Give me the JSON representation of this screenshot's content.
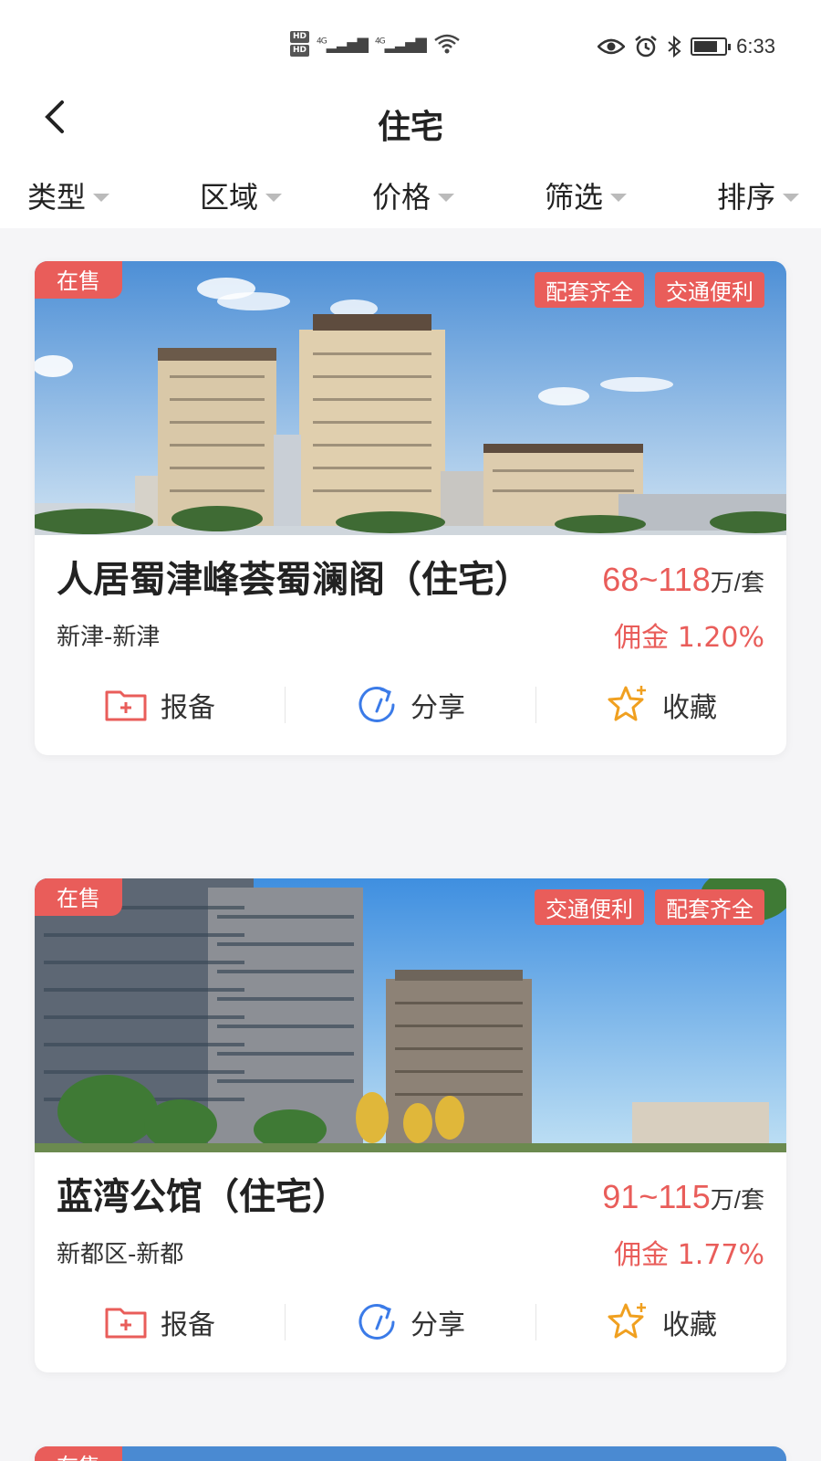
{
  "status": {
    "time": "6:33",
    "hd1": "HD",
    "hd2": "HD",
    "net1": "4G",
    "net2": "4G"
  },
  "header": {
    "title": "住宅"
  },
  "filters": [
    {
      "label": "类型"
    },
    {
      "label": "区域"
    },
    {
      "label": "价格"
    },
    {
      "label": "筛选"
    },
    {
      "label": "排序"
    }
  ],
  "colors": {
    "accent": "#e95d5a",
    "share_blue": "#3b7be8",
    "star_orange": "#f0a020"
  },
  "listings": [
    {
      "status": "在售",
      "tags": [
        "配套齐全",
        "交通便利"
      ],
      "name": "人居蜀津峰荟蜀澜阁（住宅）",
      "price": "68~118",
      "unit": "万/套",
      "area": "新津-新津",
      "commission": "佣金 1.20%",
      "actions": {
        "report": "报备",
        "share": "分享",
        "favorite": "收藏"
      }
    },
    {
      "status": "在售",
      "tags": [
        "交通便利",
        "配套齐全"
      ],
      "name": "蓝湾公馆（住宅）",
      "price": "91~115",
      "unit": "万/套",
      "area": "新都区-新都",
      "commission": "佣金 1.77%",
      "actions": {
        "report": "报备",
        "share": "分享",
        "favorite": "收藏"
      }
    },
    {
      "status": "在售"
    }
  ]
}
